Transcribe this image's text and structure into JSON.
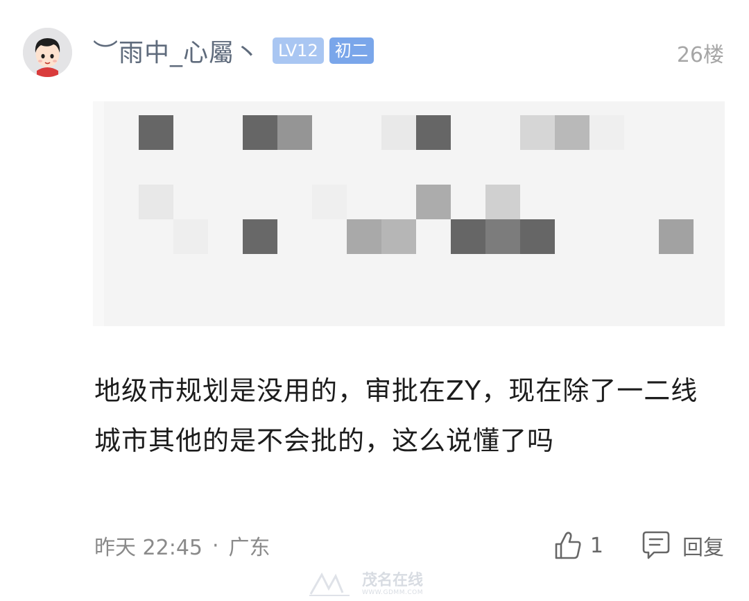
{
  "comment": {
    "username": "︶雨中_心屬丶",
    "badges": {
      "level": "LV12",
      "grade": "初二"
    },
    "floor": "26楼",
    "avatar_icon": "cartoon-boy-avatar",
    "quoted_image": {
      "content": "pixelated-redacted-image"
    },
    "text": "地级市规划是没用的，审批在ZY，现在除了一二线城市其他的是不会批的，这么说懂了吗",
    "time": "昨天 22:45",
    "separator": "·",
    "location": "广东"
  },
  "actions": {
    "like_icon": "thumbs-up-icon",
    "like_count": "1",
    "reply_icon": "comment-icon",
    "reply_label": "回复"
  },
  "watermark": {
    "main": "茂名在线",
    "sub": "WWW.GDMM.COM"
  },
  "colors": {
    "username": "#5f6b7c",
    "level_badge": "#a9c6f2",
    "grade_badge": "#7aa6ea",
    "floor_text": "#a6a6a6",
    "body_text": "#1c1c1c",
    "meta_text": "#8a8a8a"
  }
}
